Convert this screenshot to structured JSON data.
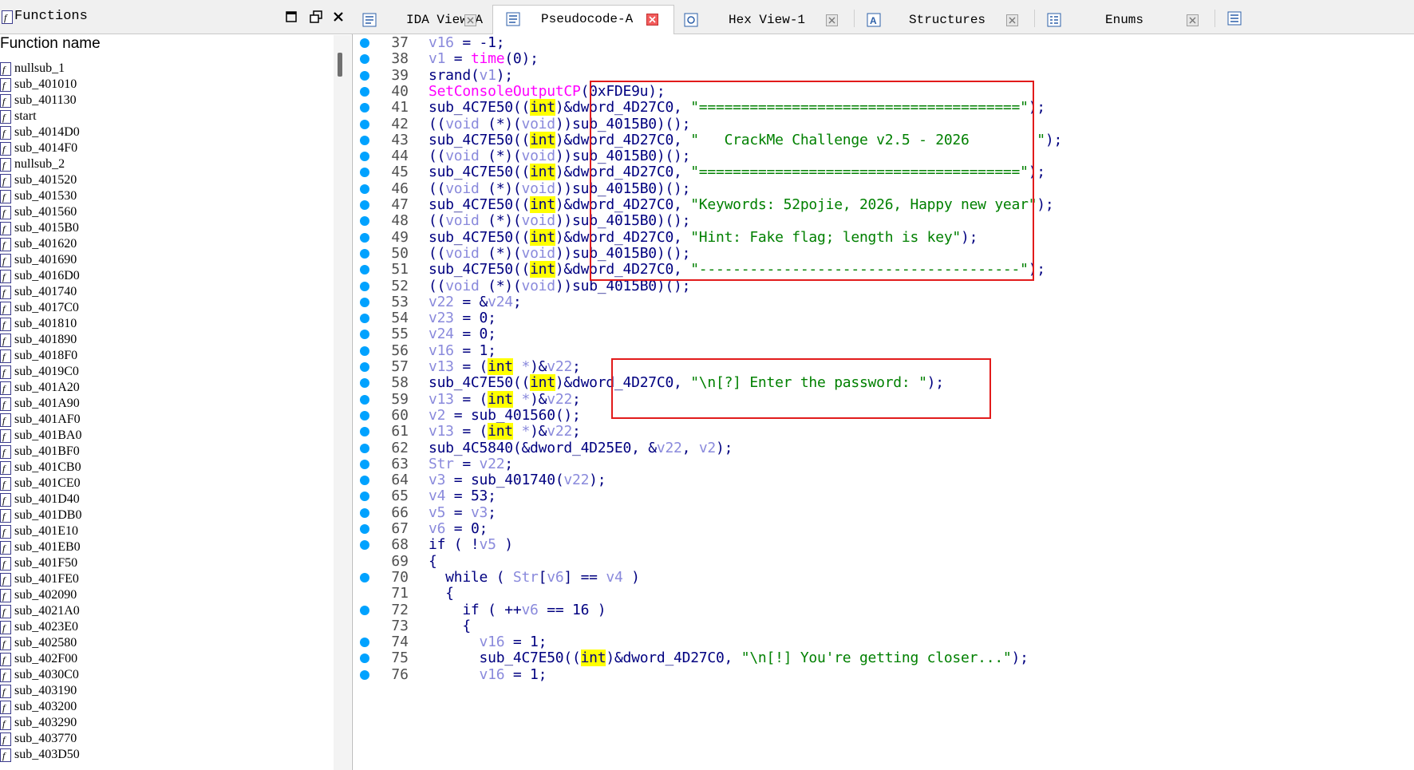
{
  "functions_pane": {
    "title": "Functions",
    "column_header": "Function name",
    "items": [
      "nullsub_1",
      "sub_401010",
      "sub_401130",
      "start",
      "sub_4014D0",
      "sub_4014F0",
      "nullsub_2",
      "sub_401520",
      "sub_401530",
      "sub_401560",
      "sub_4015B0",
      "sub_401620",
      "sub_401690",
      "sub_4016D0",
      "sub_401740",
      "sub_4017C0",
      "sub_401810",
      "sub_401890",
      "sub_4018F0",
      "sub_4019C0",
      "sub_401A20",
      "sub_401A90",
      "sub_401AF0",
      "sub_401BA0",
      "sub_401BF0",
      "sub_401CB0",
      "sub_401CE0",
      "sub_401D40",
      "sub_401DB0",
      "sub_401E10",
      "sub_401EB0",
      "sub_401F50",
      "sub_401FE0",
      "sub_402090",
      "sub_4021A0",
      "sub_4023E0",
      "sub_402580",
      "sub_402F00",
      "sub_4030C0",
      "sub_403190",
      "sub_403200",
      "sub_403290",
      "sub_403770",
      "sub_403D50"
    ]
  },
  "tabs": [
    {
      "label": "IDA View-A",
      "icon": "ida-view-icon"
    },
    {
      "label": "Pseudocode-A",
      "icon": "pseudocode-icon",
      "active": true
    },
    {
      "label": "Hex View-1",
      "icon": "hex-view-icon"
    },
    {
      "label": "Structures",
      "icon": "structures-icon"
    },
    {
      "label": "Enums",
      "icon": "enums-icon"
    }
  ],
  "colors": {
    "breakpoint": "#00a2ff",
    "annotation": "#e21b1b",
    "int_highlight": "#ffff00",
    "string": "#008000",
    "import": "#ff00ff",
    "variable": "#8a8adc",
    "identifier": "#000080"
  },
  "code_lines": [
    {
      "n": "37",
      "bp": true,
      "tokens": [
        [
          "var",
          "v16"
        ],
        [
          "op",
          " = -1;"
        ]
      ]
    },
    {
      "n": "38",
      "bp": true,
      "tokens": [
        [
          "var",
          "v1"
        ],
        [
          "op",
          " = "
        ],
        [
          "imp",
          "time"
        ],
        [
          "op",
          "(0);"
        ]
      ]
    },
    {
      "n": "39",
      "bp": true,
      "tokens": [
        [
          "name",
          "srand"
        ],
        [
          "op",
          "("
        ],
        [
          "var",
          "v1"
        ],
        [
          "op",
          ");"
        ]
      ]
    },
    {
      "n": "40",
      "bp": true,
      "tokens": [
        [
          "imp",
          "SetConsoleOutputCP"
        ],
        [
          "op",
          "(0xFDE9u);"
        ]
      ]
    },
    {
      "n": "41",
      "bp": true,
      "tokens": [
        [
          "name",
          "sub_4C7E50"
        ],
        [
          "op",
          "(("
        ],
        [
          "int",
          "int"
        ],
        [
          "op",
          ")&dword_4D27C0, "
        ],
        [
          "str",
          "\"======================================\""
        ],
        [
          "op",
          ");"
        ]
      ]
    },
    {
      "n": "42",
      "bp": true,
      "tokens": [
        [
          "op",
          "(("
        ],
        [
          "void",
          "void"
        ],
        [
          "op",
          " (*)("
        ],
        [
          "void",
          "void"
        ],
        [
          "op",
          "))sub_4015B0)();"
        ]
      ]
    },
    {
      "n": "43",
      "bp": true,
      "tokens": [
        [
          "name",
          "sub_4C7E50"
        ],
        [
          "op",
          "(("
        ],
        [
          "int",
          "int"
        ],
        [
          "op",
          ")&dword_4D27C0, "
        ],
        [
          "str",
          "\"   CrackMe Challenge v2.5 - 2026        \""
        ],
        [
          "op",
          ");"
        ]
      ]
    },
    {
      "n": "44",
      "bp": true,
      "tokens": [
        [
          "op",
          "(("
        ],
        [
          "void",
          "void"
        ],
        [
          "op",
          " (*)("
        ],
        [
          "void",
          "void"
        ],
        [
          "op",
          "))sub_4015B0)();"
        ]
      ]
    },
    {
      "n": "45",
      "bp": true,
      "tokens": [
        [
          "name",
          "sub_4C7E50"
        ],
        [
          "op",
          "(("
        ],
        [
          "int",
          "int"
        ],
        [
          "op",
          ")&dword_4D27C0, "
        ],
        [
          "str",
          "\"======================================\""
        ],
        [
          "op",
          ");"
        ]
      ]
    },
    {
      "n": "46",
      "bp": true,
      "tokens": [
        [
          "op",
          "(("
        ],
        [
          "void",
          "void"
        ],
        [
          "op",
          " (*)("
        ],
        [
          "void",
          "void"
        ],
        [
          "op",
          "))sub_4015B0)();"
        ]
      ]
    },
    {
      "n": "47",
      "bp": true,
      "tokens": [
        [
          "name",
          "sub_4C7E50"
        ],
        [
          "op",
          "(("
        ],
        [
          "int",
          "int"
        ],
        [
          "op",
          ")&dword_4D27C0, "
        ],
        [
          "str",
          "\"Keywords: 52pojie, 2026, Happy new year\""
        ],
        [
          "op",
          ");"
        ]
      ]
    },
    {
      "n": "48",
      "bp": true,
      "tokens": [
        [
          "op",
          "(("
        ],
        [
          "void",
          "void"
        ],
        [
          "op",
          " (*)("
        ],
        [
          "void",
          "void"
        ],
        [
          "op",
          "))sub_4015B0)();"
        ]
      ]
    },
    {
      "n": "49",
      "bp": true,
      "tokens": [
        [
          "name",
          "sub_4C7E50"
        ],
        [
          "op",
          "(("
        ],
        [
          "int",
          "int"
        ],
        [
          "op",
          ")&dword_4D27C0, "
        ],
        [
          "str",
          "\"Hint: Fake flag; length is key\""
        ],
        [
          "op",
          ");"
        ]
      ]
    },
    {
      "n": "50",
      "bp": true,
      "tokens": [
        [
          "op",
          "(("
        ],
        [
          "void",
          "void"
        ],
        [
          "op",
          " (*)("
        ],
        [
          "void",
          "void"
        ],
        [
          "op",
          "))sub_4015B0)();"
        ]
      ]
    },
    {
      "n": "51",
      "bp": true,
      "tokens": [
        [
          "name",
          "sub_4C7E50"
        ],
        [
          "op",
          "(("
        ],
        [
          "int",
          "int"
        ],
        [
          "op",
          ")&dword_4D27C0, "
        ],
        [
          "str",
          "\"--------------------------------------\""
        ],
        [
          "op",
          ");"
        ]
      ]
    },
    {
      "n": "52",
      "bp": true,
      "tokens": [
        [
          "op",
          "(("
        ],
        [
          "void",
          "void"
        ],
        [
          "op",
          " (*)("
        ],
        [
          "void",
          "void"
        ],
        [
          "op",
          "))sub_4015B0)();"
        ]
      ]
    },
    {
      "n": "53",
      "bp": true,
      "tokens": [
        [
          "var",
          "v22"
        ],
        [
          "op",
          " = &"
        ],
        [
          "var",
          "v24"
        ],
        [
          "op",
          ";"
        ]
      ]
    },
    {
      "n": "54",
      "bp": true,
      "tokens": [
        [
          "var",
          "v23"
        ],
        [
          "op",
          " = 0;"
        ]
      ]
    },
    {
      "n": "55",
      "bp": true,
      "tokens": [
        [
          "var",
          "v24"
        ],
        [
          "op",
          " = 0;"
        ]
      ]
    },
    {
      "n": "56",
      "bp": true,
      "tokens": [
        [
          "var",
          "v16"
        ],
        [
          "op",
          " = 1;"
        ]
      ]
    },
    {
      "n": "57",
      "bp": true,
      "tokens": [
        [
          "var",
          "v13"
        ],
        [
          "op",
          " = ("
        ],
        [
          "int",
          "int"
        ],
        [
          "void",
          " *"
        ],
        [
          "op",
          ")&"
        ],
        [
          "var",
          "v22"
        ],
        [
          "op",
          ";"
        ]
      ]
    },
    {
      "n": "58",
      "bp": true,
      "tokens": [
        [
          "name",
          "sub_4C7E50"
        ],
        [
          "op",
          "(("
        ],
        [
          "int",
          "int"
        ],
        [
          "op",
          ")&dword_4D27C0, "
        ],
        [
          "str",
          "\"\\n[?] Enter the password: \""
        ],
        [
          "op",
          ");"
        ]
      ]
    },
    {
      "n": "59",
      "bp": true,
      "tokens": [
        [
          "var",
          "v13"
        ],
        [
          "op",
          " = ("
        ],
        [
          "int",
          "int"
        ],
        [
          "void",
          " *"
        ],
        [
          "op",
          ")&"
        ],
        [
          "var",
          "v22"
        ],
        [
          "op",
          ";"
        ]
      ]
    },
    {
      "n": "60",
      "bp": true,
      "tokens": [
        [
          "var",
          "v2"
        ],
        [
          "op",
          " = sub_401560();"
        ]
      ]
    },
    {
      "n": "61",
      "bp": true,
      "tokens": [
        [
          "var",
          "v13"
        ],
        [
          "op",
          " = ("
        ],
        [
          "int",
          "int"
        ],
        [
          "void",
          " *"
        ],
        [
          "op",
          ")&"
        ],
        [
          "var",
          "v22"
        ],
        [
          "op",
          ";"
        ]
      ]
    },
    {
      "n": "62",
      "bp": true,
      "tokens": [
        [
          "name",
          "sub_4C5840"
        ],
        [
          "op",
          "(&dword_4D25E0, &"
        ],
        [
          "var",
          "v22"
        ],
        [
          "op",
          ", "
        ],
        [
          "var",
          "v2"
        ],
        [
          "op",
          ");"
        ]
      ]
    },
    {
      "n": "63",
      "bp": true,
      "tokens": [
        [
          "var",
          "Str"
        ],
        [
          "op",
          " = "
        ],
        [
          "var",
          "v22"
        ],
        [
          "op",
          ";"
        ]
      ]
    },
    {
      "n": "64",
      "bp": true,
      "tokens": [
        [
          "var",
          "v3"
        ],
        [
          "op",
          " = sub_401740("
        ],
        [
          "var",
          "v22"
        ],
        [
          "op",
          ");"
        ]
      ]
    },
    {
      "n": "65",
      "bp": true,
      "tokens": [
        [
          "var",
          "v4"
        ],
        [
          "op",
          " = 53;"
        ]
      ]
    },
    {
      "n": "66",
      "bp": true,
      "tokens": [
        [
          "var",
          "v5"
        ],
        [
          "op",
          " = "
        ],
        [
          "var",
          "v3"
        ],
        [
          "op",
          ";"
        ]
      ]
    },
    {
      "n": "67",
      "bp": true,
      "tokens": [
        [
          "var",
          "v6"
        ],
        [
          "op",
          " = 0;"
        ]
      ]
    },
    {
      "n": "68",
      "bp": true,
      "tokens": [
        [
          "op",
          "if ( !"
        ],
        [
          "var",
          "v5"
        ],
        [
          "op",
          " )"
        ]
      ]
    },
    {
      "n": "69",
      "bp": false,
      "tokens": [
        [
          "op",
          "{"
        ]
      ]
    },
    {
      "n": "70",
      "bp": true,
      "tokens": [
        [
          "op",
          "  while ( "
        ],
        [
          "var",
          "Str"
        ],
        [
          "op",
          "["
        ],
        [
          "var",
          "v6"
        ],
        [
          "op",
          "] == "
        ],
        [
          "var",
          "v4"
        ],
        [
          "op",
          " )"
        ]
      ]
    },
    {
      "n": "71",
      "bp": false,
      "tokens": [
        [
          "op",
          "  {"
        ]
      ]
    },
    {
      "n": "72",
      "bp": true,
      "tokens": [
        [
          "op",
          "    if ( ++"
        ],
        [
          "var",
          "v6"
        ],
        [
          "op",
          " == 16 )"
        ]
      ]
    },
    {
      "n": "73",
      "bp": false,
      "tokens": [
        [
          "op",
          "    {"
        ]
      ]
    },
    {
      "n": "74",
      "bp": true,
      "tokens": [
        [
          "op",
          "      "
        ],
        [
          "var",
          "v16"
        ],
        [
          "op",
          " = 1;"
        ]
      ]
    },
    {
      "n": "75",
      "bp": true,
      "tokens": [
        [
          "op",
          "      sub_4C7E50(("
        ],
        [
          "int",
          "int"
        ],
        [
          "op",
          ")&dword_4D27C0, "
        ],
        [
          "str",
          "\"\\n[!] You're getting closer...\""
        ],
        [
          "op",
          ");"
        ]
      ]
    },
    {
      "n": "76",
      "bp": true,
      "tokens": [
        [
          "op",
          "      "
        ],
        [
          "var",
          "v16"
        ],
        [
          "op",
          " = 1;"
        ]
      ]
    }
  ]
}
